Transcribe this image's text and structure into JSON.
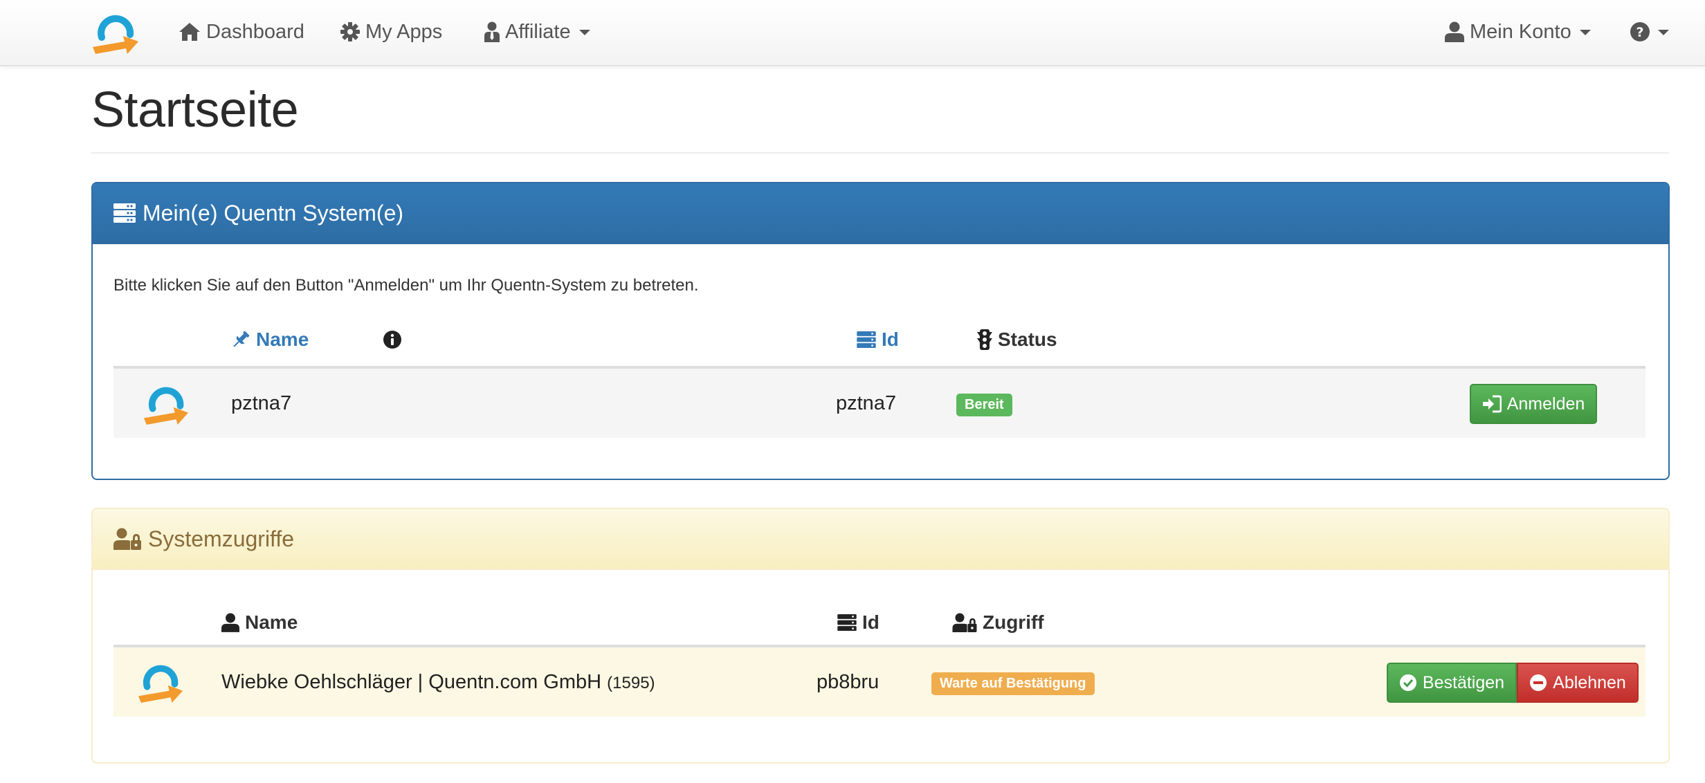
{
  "nav": {
    "items": [
      {
        "label": "Dashboard",
        "icon": "home-icon"
      },
      {
        "label": "My Apps",
        "icon": "gear-icon"
      },
      {
        "label": "Affiliate",
        "icon": "user-tie-icon",
        "dropdown": true
      }
    ],
    "account_label": "Mein Konto",
    "help_icon": "question-circle-icon"
  },
  "page": {
    "title": "Startseite"
  },
  "systems_panel": {
    "title": "Mein(e) Quentn System(e)",
    "intro": "Bitte klicken Sie auf den Button \"Anmelden\" um Ihr Quentn-System zu betreten.",
    "columns": {
      "name": "Name",
      "id": "Id",
      "status": "Status"
    },
    "rows": [
      {
        "name": "pztna7",
        "id": "pztna7",
        "status": "Bereit",
        "action": "Anmelden"
      }
    ]
  },
  "access_panel": {
    "title": "Systemzugriffe",
    "columns": {
      "name": "Name",
      "id": "Id",
      "access": "Zugriff"
    },
    "rows": [
      {
        "name": "Wiebke Oehlschläger | Quentn.com GmbH",
        "number": "(1595)",
        "id": "pb8bru",
        "status": "Warte auf Bestätigung",
        "confirm": "Bestätigen",
        "reject": "Ablehnen"
      }
    ]
  },
  "colors": {
    "primary": "#337ab7",
    "success": "#5cb85c",
    "warning": "#f0ad4e",
    "danger": "#d9534f",
    "logo_blue": "#1fa3d6",
    "logo_orange": "#f39a2c"
  }
}
